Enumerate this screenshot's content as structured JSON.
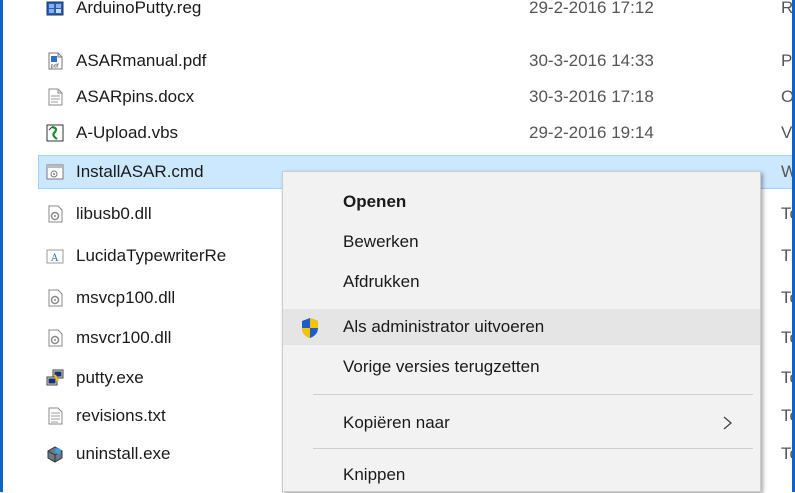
{
  "files": [
    {
      "name": "ArduinoPutty.reg",
      "date": "29-2-2016 17:12",
      "type": "Reg",
      "icon": "registry-icon"
    },
    {
      "name": "ASARmanual.pdf",
      "date": "30-3-2016 14:33",
      "type": "PDF",
      "icon": "pdf-file-icon"
    },
    {
      "name": "ASARpins.docx",
      "date": "30-3-2016 17:18",
      "type": "Off",
      "icon": "document-icon"
    },
    {
      "name": "A-Upload.vbs",
      "date": "29-2-2016 19:14",
      "type": "VBS",
      "icon": "script-icon"
    },
    {
      "name": "InstallASAR.cmd",
      "date": "",
      "type": "Win",
      "icon": "cmd-file-icon"
    },
    {
      "name": "libusb0.dll",
      "date": "",
      "type": "Toe",
      "icon": "dll-file-icon"
    },
    {
      "name": "LucidaTypewriterRe",
      "date": "",
      "type": "Tru",
      "icon": "font-file-icon"
    },
    {
      "name": "msvcp100.dll",
      "date": "",
      "type": "Toe",
      "icon": "dll-file-icon"
    },
    {
      "name": "msvcr100.dll",
      "date": "",
      "type": "Toe",
      "icon": "dll-file-icon"
    },
    {
      "name": "putty.exe",
      "date": "",
      "type": "Toe",
      "icon": "putty-app-icon"
    },
    {
      "name": "revisions.txt",
      "date": "",
      "type": "Tek",
      "icon": "text-file-icon"
    },
    {
      "name": "uninstall.exe",
      "date": "",
      "type": "Toe",
      "icon": "uninstaller-icon"
    }
  ],
  "context_menu": {
    "items": [
      {
        "label": "Openen",
        "bold": true
      },
      {
        "label": "Bewerken"
      },
      {
        "label": "Afdrukken"
      },
      {
        "label": "Als administrator uitvoeren",
        "icon": "uac-shield-icon",
        "hover": true
      },
      {
        "label": "Vorige versies terugzetten"
      },
      {
        "label": "Kopiëren naar",
        "submenu": true
      },
      {
        "label": "Knippen"
      }
    ]
  },
  "colors": {
    "selection_bg": "#cce8ff",
    "selection_border": "#99d1ff",
    "menu_bg": "#f2f2f2",
    "menu_hover": "#e5e5e5",
    "window_border": "#0f62c8"
  }
}
